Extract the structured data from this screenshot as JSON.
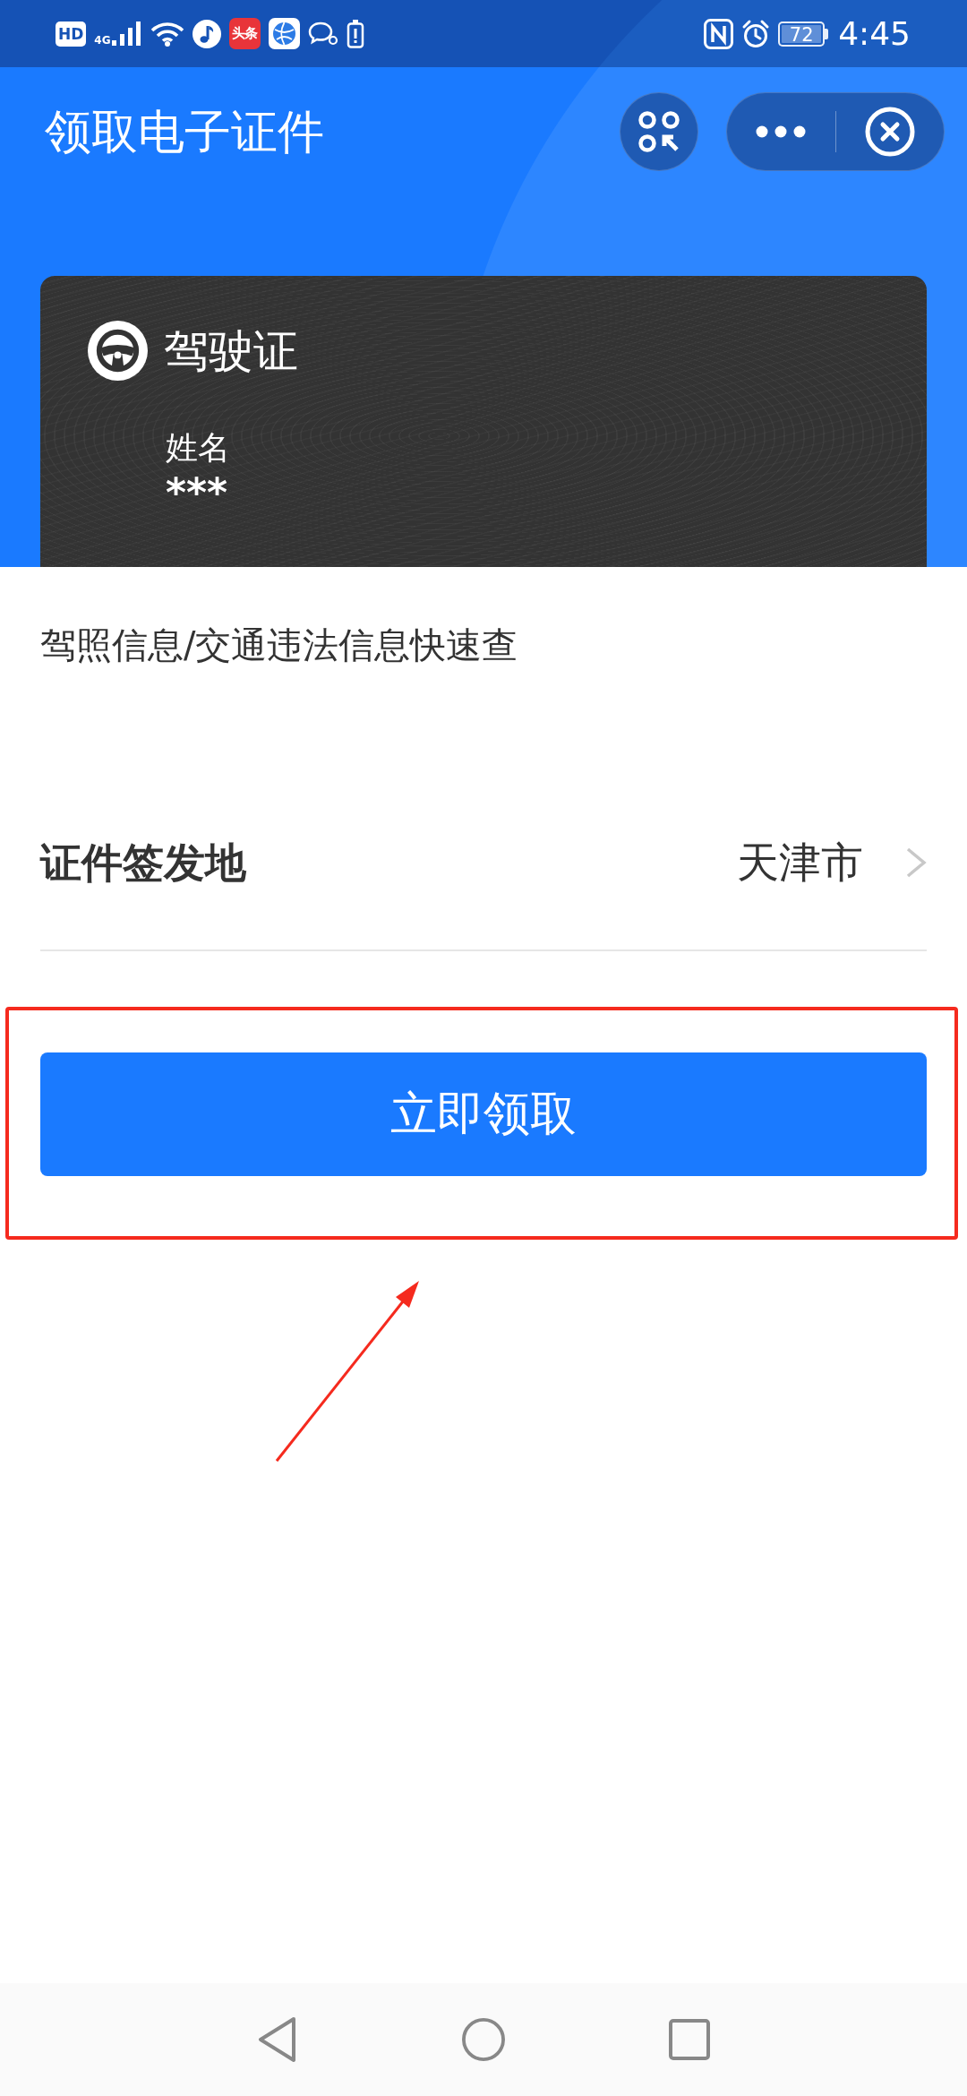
{
  "status_bar": {
    "hd": "HD",
    "network": "4G",
    "app_label": "头条",
    "battery": "72",
    "time": "4:45"
  },
  "header": {
    "title": "领取电子证件"
  },
  "card": {
    "title": "驾驶证",
    "field_label": "姓名",
    "field_value": "***"
  },
  "description": "驾照信息/交通违法信息快速查",
  "issuer_row": {
    "label": "证件签发地",
    "value": "天津市"
  },
  "primary_button": "立即领取"
}
